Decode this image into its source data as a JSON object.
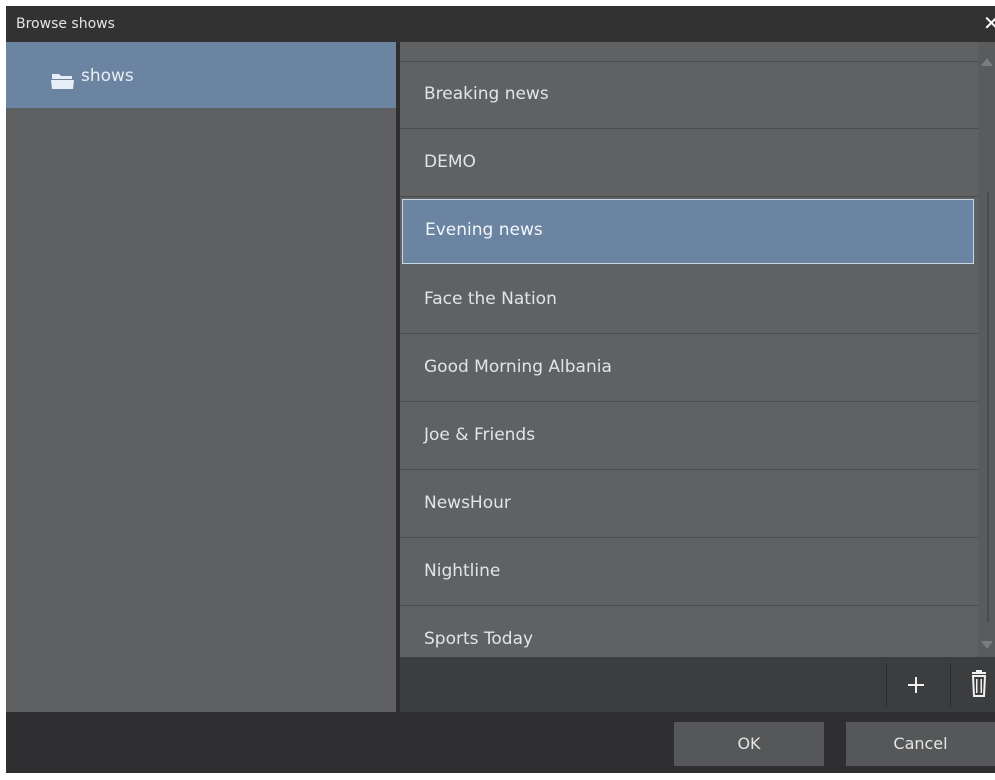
{
  "window": {
    "title": "Browse shows",
    "close_glyph": "✕"
  },
  "tree": {
    "items": [
      {
        "label": "shows",
        "icon": "folder-open-icon",
        "selected": true
      }
    ]
  },
  "list": {
    "items": [
      {
        "label": "Breaking news"
      },
      {
        "label": "DEMO"
      },
      {
        "label": "Evening news",
        "selected": true
      },
      {
        "label": "Face the Nation"
      },
      {
        "label": "Good Morning Albania"
      },
      {
        "label": "Joe & Friends"
      },
      {
        "label": "NewsHour"
      },
      {
        "label": "Nightline"
      },
      {
        "label": "Sports Today"
      }
    ]
  },
  "toolbar": {
    "add_icon": "plus-icon",
    "delete_icon": "trash-icon"
  },
  "footer": {
    "ok_label": "OK",
    "cancel_label": "Cancel"
  },
  "colors": {
    "selection": "#6b84a1",
    "panel": "#5f6163",
    "background": "#3a3a3c"
  }
}
